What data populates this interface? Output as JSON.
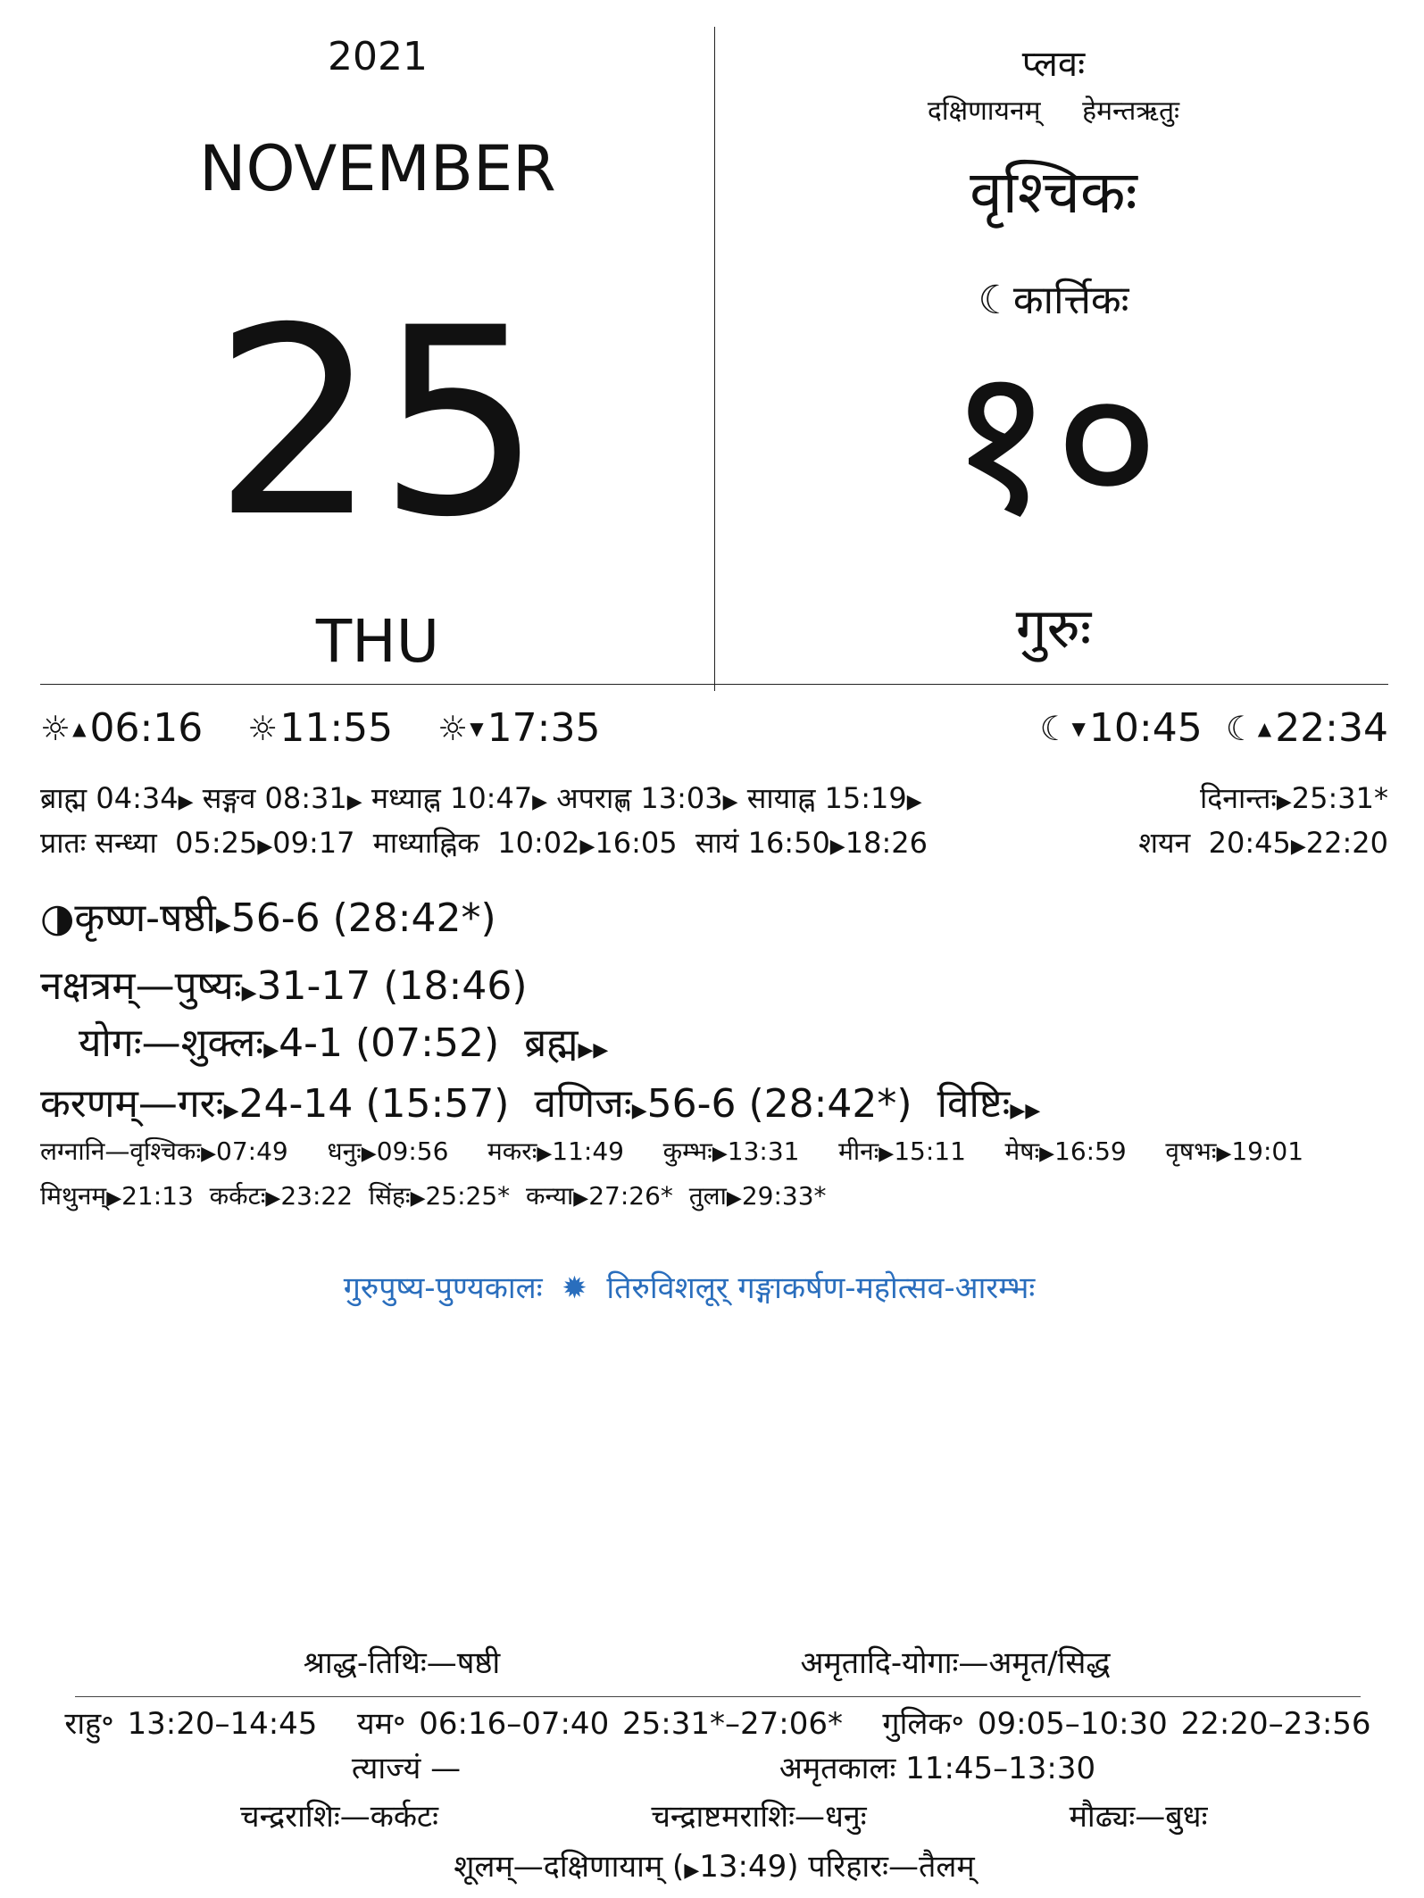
{
  "header": {
    "year": "2021",
    "month": "NOVEMBER",
    "day": "25",
    "weekday": "THU",
    "samvatsara": "प्लवः",
    "ayana": "दक्षिणायनम्",
    "ritu": "हेमन्तऋतुः",
    "solar_month": "वृश्चिकः",
    "lunar_month": "☾कार्त्तिकः",
    "lunar_day": "१०",
    "vara": "गुरुः"
  },
  "sun_moon": {
    "sunrise": "06:16",
    "noon": "11:55",
    "sunset": "17:35",
    "moonset": "10:45",
    "moonrise": "22:34"
  },
  "day_parts": {
    "row1": [
      {
        "label": "ब्राह्म",
        "time": "04:34"
      },
      {
        "label": "सङ्गव",
        "time": "08:31"
      },
      {
        "label": "मध्याह्न",
        "time": "10:47"
      },
      {
        "label": "अपराह्ण",
        "time": "13:03"
      },
      {
        "label": "सायाह्न",
        "time": "15:19"
      }
    ],
    "dinanta": "दिनान्तः",
    "dinanta_time": "25:31*",
    "row2": [
      {
        "label": "प्रातः सन्ध्या",
        "from": "05:25",
        "to": "09:17"
      },
      {
        "label": "माध्याह्निक",
        "from": "10:02",
        "to": "16:05"
      },
      {
        "label": "सायं",
        "from": "16:50",
        "to": "18:26"
      }
    ],
    "shayana": "शयन",
    "shayana_from": "20:45",
    "shayana_to": "22:20"
  },
  "tithi": {
    "name": "कृष्ण-षष्ठी",
    "value": "56-6 (28:42*)"
  },
  "nakshatra": {
    "label": "नक्षत्रम्—पुष्यः",
    "value": "31-17 (18:46)"
  },
  "yoga": {
    "label": "योगः—शुक्लः",
    "value": "4-1 (07:52)",
    "next": "ब्रह्म"
  },
  "karana": {
    "label": "करणम्—गरः",
    "value": "24-14 (15:57)",
    "second_name": "वणिजः",
    "second_value": "56-6 (28:42*)",
    "next": "विष्टिः"
  },
  "lagnas": {
    "row1": [
      {
        "name": "लग्नानि—वृश्चिकः",
        "time": "07:49"
      },
      {
        "name": "धनुः",
        "time": "09:56"
      },
      {
        "name": "मकरः",
        "time": "11:49"
      },
      {
        "name": "कुम्भः",
        "time": "13:31"
      },
      {
        "name": "मीनः",
        "time": "15:11"
      },
      {
        "name": "मेषः",
        "time": "16:59"
      },
      {
        "name": "वृषभः",
        "time": "19:01"
      }
    ],
    "row2": [
      {
        "name": "मिथुनम्",
        "time": "21:13"
      },
      {
        "name": "कर्कटः",
        "time": "23:22"
      },
      {
        "name": "सिंहः",
        "time": "25:25*"
      },
      {
        "name": "कन्या",
        "time": "27:26*"
      },
      {
        "name": "तुला",
        "time": "29:33*"
      }
    ]
  },
  "festivals": {
    "first": "गुरुपुष्य-पुण्यकालः",
    "separator": "✹",
    "second": "तिरुविशलूर् गङ्गाकर्षण-महोत्सव-आरम्भः"
  },
  "footer": {
    "shraddha": "श्राद्ध-तिथिः—षष्ठी",
    "amritadi": "अमृतादि-योगाः—अमृत/सिद्ध",
    "rahu": "राहु॰ 13:20–14:45",
    "yama": "यम॰ 06:16–07:40 25:31*–27:06*",
    "gulika": "गुलिक॰ 09:05–10:30 22:20–23:56",
    "tyajyam": "त्याज्यं —",
    "amritakala": "अमृतकालः 11:45–13:30",
    "chandrarashi": "चन्द्रराशिः—कर्कटः",
    "chandrashtama": "चन्द्राष्टमराशिः—धनुः",
    "maudhya": "मौढ्यः—बुधः",
    "shoolam": "शूलम्—दक्षिणायाम् (",
    "shoolam_time": "13:49",
    "parihara": ") परिहारः—तैलम्"
  },
  "colors": {
    "festival": "#2a6ebd",
    "text": "#111111"
  },
  "icons": {
    "sun": "sun-icon",
    "moon": "moon-icon",
    "half_moon": "half-moon-icon",
    "arrow": "right-triangle-icon"
  }
}
